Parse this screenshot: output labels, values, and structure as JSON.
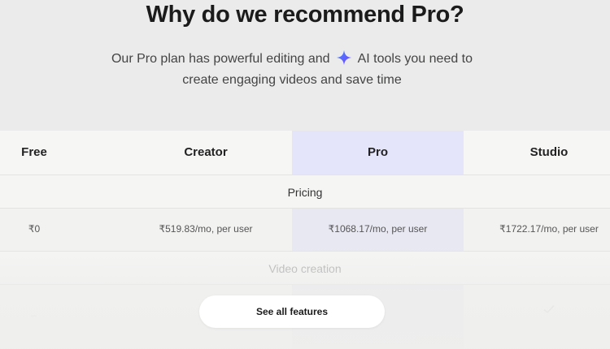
{
  "hero": {
    "title": "Why do we recommend Pro?",
    "subtitle_part1": "Our Pro plan has powerful editing and",
    "subtitle_part2": "AI tools you need to",
    "subtitle_line2": "create engaging videos and save time",
    "sparkle_icon": "sparkle-icon",
    "sparkle_color": "#5b5bf0"
  },
  "plans": {
    "free": "Free",
    "creator": "Creator",
    "pro": "Pro",
    "studio": "Studio"
  },
  "sections": {
    "pricing": "Pricing",
    "video_creation": "Video creation"
  },
  "prices": {
    "free": "₹0",
    "creator": "₹519.83/mo, per user",
    "pro": "₹1068.17/mo, per user",
    "studio": "₹1722.17/mo, per user"
  },
  "features": {
    "free_value": "–",
    "studio_icon": "check-icon"
  },
  "cta": {
    "see_all": "See all features"
  },
  "colors": {
    "pro_highlight": "#e4e5fb",
    "background": "#eaebea"
  }
}
